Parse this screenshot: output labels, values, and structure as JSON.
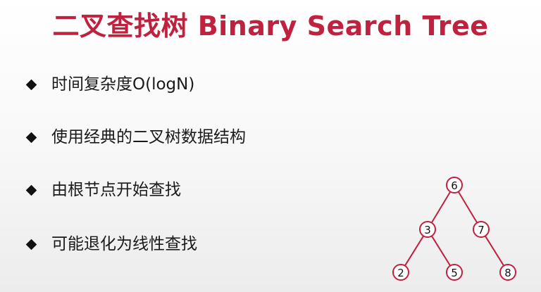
{
  "title": "二叉查找树 Binary Search Tree",
  "bullets": [
    {
      "text": "时间复杂度O(logN)"
    },
    {
      "text": "使用经典的二叉树数据结构"
    },
    {
      "text": "由根节点开始查找"
    },
    {
      "text": "可能退化为线性查找"
    }
  ],
  "bullet_icon": "diamond-icon",
  "colors": {
    "title": "#c0213f",
    "tree_stroke": "#c0213f",
    "text": "#1a1a1a"
  },
  "tree": {
    "nodes": [
      {
        "id": "n6",
        "label": "6"
      },
      {
        "id": "n3",
        "label": "3"
      },
      {
        "id": "n7",
        "label": "7"
      },
      {
        "id": "n2",
        "label": "2"
      },
      {
        "id": "n5",
        "label": "5"
      },
      {
        "id": "n8",
        "label": "8"
      }
    ],
    "edges": [
      {
        "from": "n6",
        "to": "n3"
      },
      {
        "from": "n6",
        "to": "n7"
      },
      {
        "from": "n3",
        "to": "n2"
      },
      {
        "from": "n3",
        "to": "n5"
      },
      {
        "from": "n7",
        "to": "n8"
      }
    ]
  }
}
